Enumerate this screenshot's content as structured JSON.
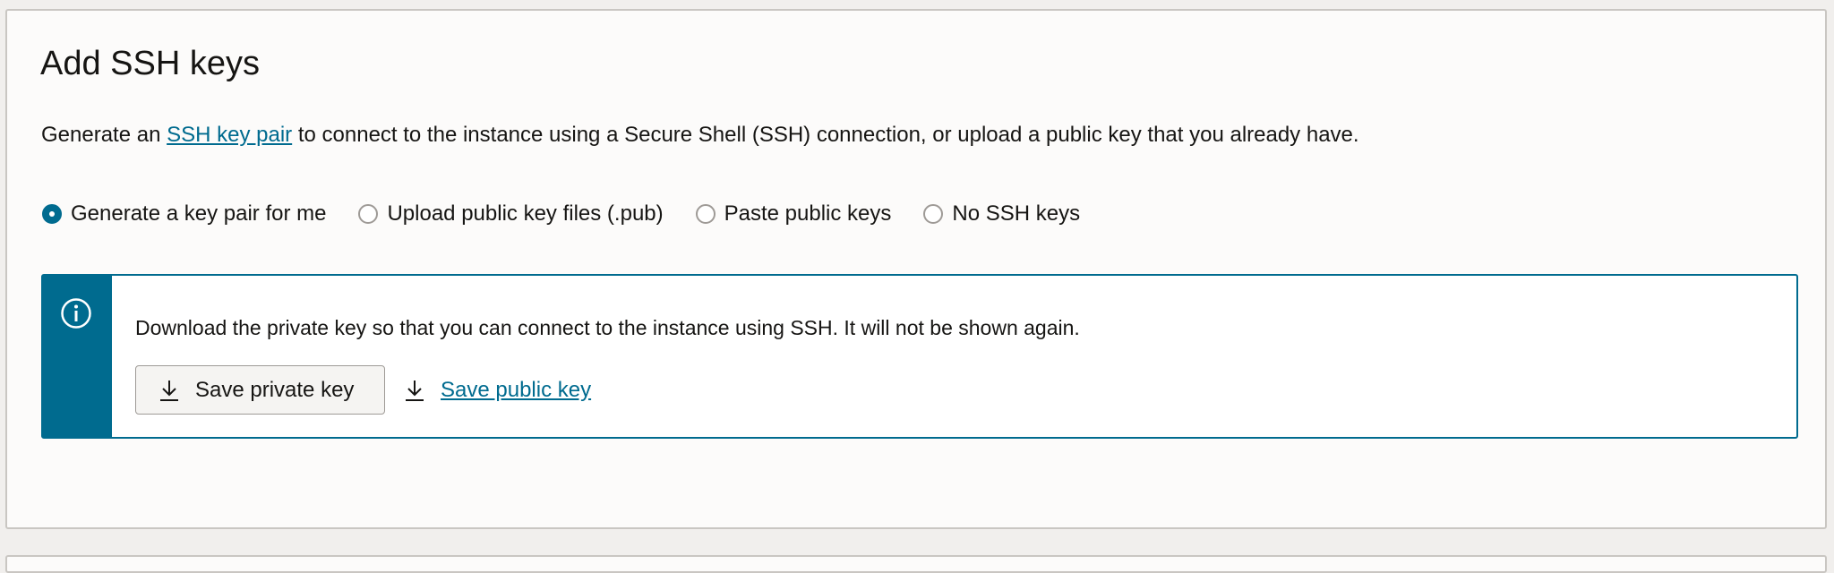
{
  "panel": {
    "title": "Add SSH keys",
    "description": {
      "prefix": "Generate an ",
      "link": "SSH key pair",
      "suffix": " to connect to the instance using a Secure Shell (SSH) connection, or upload a public key that you already have."
    },
    "radio_options": [
      {
        "label": "Generate a key pair for me",
        "checked": true
      },
      {
        "label": "Upload public key files (.pub)",
        "checked": false
      },
      {
        "label": "Paste public keys",
        "checked": false
      },
      {
        "label": "No SSH keys",
        "checked": false
      }
    ],
    "info": {
      "message": "Download the private key so that you can connect to the instance using SSH. It will not be shown again.",
      "save_private_label": "Save private key",
      "save_public_label": "Save public key",
      "icon": "info-icon"
    }
  },
  "colors": {
    "accent": "#006b8f",
    "text": "#161513",
    "panel_bg": "#fcfbfa",
    "page_bg": "#f1efed",
    "border": "#c9c6c2"
  }
}
